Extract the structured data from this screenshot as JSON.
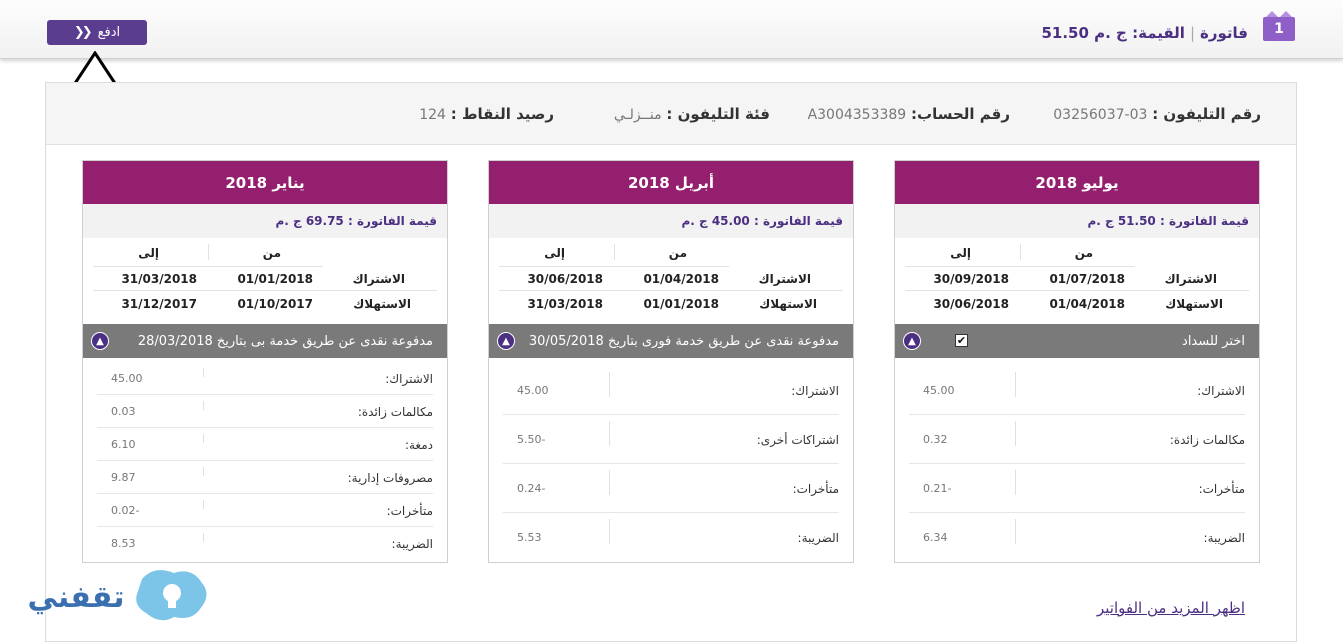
{
  "topbar": {
    "pay_label": "ادفع",
    "invoice_word": "فاتورة",
    "value_label": "القيمة:",
    "value_amount": "ج .م 51.50",
    "badge_count": "1"
  },
  "account": {
    "phone_label": "رقم التليفون :",
    "phone_value": "03-03256037",
    "account_label": "رقم الحساب:",
    "account_value": "A3004353389",
    "category_label": "فئة التليفون :",
    "category_value": "منــزلـي",
    "points_label": "رصيد النقاط :",
    "points_value": "124"
  },
  "table_headers": {
    "from": "من",
    "to": "إلى",
    "subscription": "الاشتراك",
    "consumption": "الاستهلاك"
  },
  "cards": [
    {
      "month": "يوليو 2018",
      "amount": "قيمة الفاتورة : 51.50 ج .م",
      "sub_from": "01/07/2018",
      "sub_to": "30/09/2018",
      "cons_from": "01/04/2018",
      "cons_to": "30/06/2018",
      "status": "اختر للسداد",
      "charges": [
        {
          "label": "الاشتراك:",
          "value": "45.00"
        },
        {
          "label": "مكالمات زائدة:",
          "value": "0.32"
        },
        {
          "label": "متأخرات:",
          "value": "-0.21"
        },
        {
          "label": "الضريبة:",
          "value": "6.34"
        }
      ]
    },
    {
      "month": "أبريل 2018",
      "amount": "قيمة الفاتورة : 45.00 ج .م",
      "sub_from": "01/04/2018",
      "sub_to": "30/06/2018",
      "cons_from": "01/01/2018",
      "cons_to": "31/03/2018",
      "status": "مدفوعة نقدى عن طريق خدمة فورى بتاريخ 30/05/2018",
      "charges": [
        {
          "label": "الاشتراك:",
          "value": "45.00"
        },
        {
          "label": "اشتراكات أخرى:",
          "value": "-5.50"
        },
        {
          "label": "متأخرات:",
          "value": "-0.24"
        },
        {
          "label": "الضريبة:",
          "value": "5.53"
        }
      ]
    },
    {
      "month": "يناير 2018",
      "amount": "قيمة الفاتورة : 69.75 ج .م",
      "sub_from": "01/01/2018",
      "sub_to": "31/03/2018",
      "cons_from": "01/10/2017",
      "cons_to": "31/12/2017",
      "status": "مدفوعة نقدى عن طريق خدمة بى بتاريخ 28/03/2018",
      "charges": [
        {
          "label": "الاشتراك:",
          "value": "45.00"
        },
        {
          "label": "مكالمات زائدة:",
          "value": "0.03"
        },
        {
          "label": "دمغة:",
          "value": "6.10"
        },
        {
          "label": "مصروفات إدارية:",
          "value": "9.87"
        },
        {
          "label": "متأخرات:",
          "value": "-0.02"
        },
        {
          "label": "الضريبة:",
          "value": "8.53"
        }
      ]
    }
  ],
  "more_link": "اظهر المزيد من الفواتير",
  "watermark": {
    "text": "تقفني"
  },
  "colors": {
    "purple": "#5a3d8f",
    "card_header": "#941f6e",
    "status_gray": "#7a7a7a"
  },
  "icons": {
    "pay_chevron": "double-chevron-left-icon",
    "badge": "invoice-badge-icon",
    "collapse": "chevron-up-icon",
    "checkbox": "checkbox-checked-icon"
  }
}
